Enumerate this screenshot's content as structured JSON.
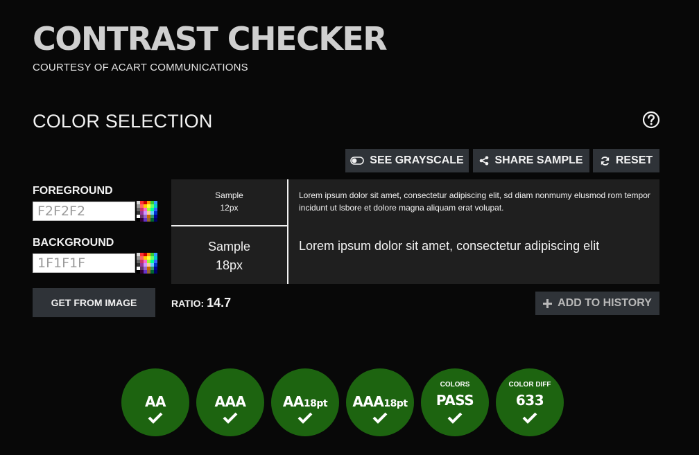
{
  "header": {
    "title": "CONTRAST CHECKER",
    "subtitle": "COURTESY OF ACART COMMUNICATIONS"
  },
  "section": {
    "title": "COLOR SELECTION",
    "help_icon": "question-circle-icon"
  },
  "toolbar": {
    "grayscale_label": "SEE GRAYSCALE",
    "share_label": "SHARE SAMPLE",
    "reset_label": "RESET"
  },
  "colors": {
    "foreground_label": "FOREGROUND",
    "foreground_value": "F2F2F2",
    "background_label": "BACKGROUND",
    "background_value": "1F1F1F",
    "get_from_image_label": "GET FROM IMAGE"
  },
  "sample": {
    "small_label": "Sample",
    "small_size": "12px",
    "small_text": "Lorem ipsum dolor sit amet, consectetur adipiscing elit, sd diam nonmumy elusmod rom tempor incidunt ut lsbore et dolore magna aliquam erat volupat.",
    "large_label": "Sample",
    "large_size": "18px",
    "large_text": "Lorem ipsum dolor sit amet, consectetur adipiscing elit"
  },
  "ratio": {
    "label": "RATIO:",
    "value": "14.7"
  },
  "history": {
    "add_label": "ADD TO HISTORY"
  },
  "results": [
    {
      "top": "",
      "main": "AA",
      "suffix": "",
      "status": "pass"
    },
    {
      "top": "",
      "main": "AAA",
      "suffix": "",
      "status": "pass"
    },
    {
      "top": "",
      "main": "AA",
      "suffix": "18pt",
      "status": "pass"
    },
    {
      "top": "",
      "main": "AAA",
      "suffix": "18pt",
      "status": "pass"
    },
    {
      "top": "COLORS",
      "main": "PASS",
      "suffix": "",
      "status": "pass"
    },
    {
      "top": "COLOR DIFF",
      "main": "633",
      "suffix": "",
      "status": "pass"
    }
  ],
  "theme": {
    "page_bg": "#080808",
    "pass_color": "#1d6410",
    "button_bg": "#2f3338",
    "foreground": "#F2F2F2",
    "background": "#1F1F1F"
  }
}
